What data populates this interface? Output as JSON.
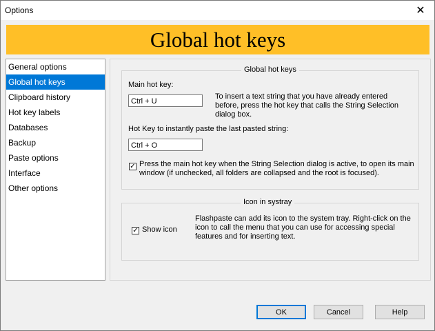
{
  "window": {
    "title": "Options"
  },
  "banner": {
    "title": "Global hot keys"
  },
  "sidebar": {
    "items": [
      {
        "label": "General options"
      },
      {
        "label": "Global hot keys"
      },
      {
        "label": "Clipboard history"
      },
      {
        "label": "Hot key labels"
      },
      {
        "label": "Databases"
      },
      {
        "label": "Backup"
      },
      {
        "label": "Paste options"
      },
      {
        "label": "Interface"
      },
      {
        "label": "Other options"
      }
    ],
    "selected": "Global hot keys"
  },
  "hotkeys_group": {
    "title": "Global hot keys",
    "main_hotkey_label": "Main hot key:",
    "main_hotkey_value": "Ctrl + U",
    "main_hotkey_desc": "To insert a text string that you have already entered before, press the hot key that calls the String Selection dialog box.",
    "paste_hotkey_label": "Hot Key to instantly paste the last pasted string:",
    "paste_hotkey_value": "Ctrl + O",
    "checkbox_label": "Press the main hot key when the String Selection dialog is active, to open its main window (if unchecked, all folders are collapsed and the root is focused).",
    "checkbox_checked": true
  },
  "systray_group": {
    "title": "Icon in systray",
    "checkbox_label": "Show icon",
    "checkbox_checked": true,
    "desc": "Flashpaste can add its icon to the system tray. Right-click on the icon to call the menu that you can use for accessing special features and for inserting text."
  },
  "buttons": {
    "ok": "OK",
    "cancel": "Cancel",
    "help": "Help"
  }
}
